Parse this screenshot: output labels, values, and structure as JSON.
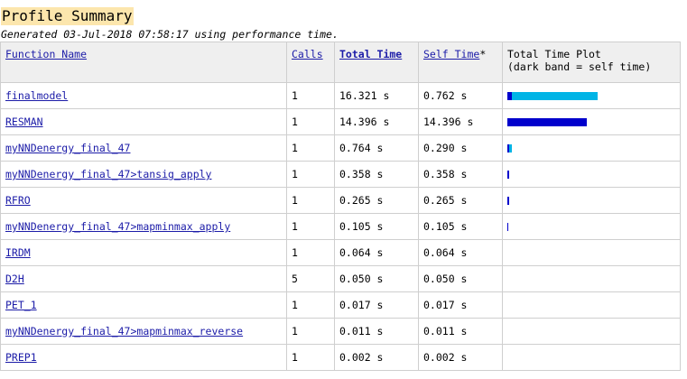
{
  "page": {
    "title": "Profile Summary",
    "subtitle": "Generated 03-Jul-2018 07:58:17 using performance time."
  },
  "table": {
    "headers": {
      "function_name": "Function Name",
      "calls": "Calls",
      "total_time": "Total Time",
      "self_time": "Self Time",
      "self_time_mark": "*",
      "plot_line1": "Total Time Plot",
      "plot_line2": "(dark band = self time)"
    },
    "rows": [
      {
        "name": "finalmodel",
        "calls": "1",
        "total": "16.321 s",
        "self": "0.762 s"
      },
      {
        "name": "RESMAN",
        "calls": "1",
        "total": "14.396 s",
        "self": "14.396 s"
      },
      {
        "name": "myNNDenergy_final_47",
        "calls": "1",
        "total": "0.764 s",
        "self": "0.290 s"
      },
      {
        "name": "myNNDenergy_final_47>tansig_apply",
        "calls": "1",
        "total": "0.358 s",
        "self": "0.358 s"
      },
      {
        "name": "RFRO",
        "calls": "1",
        "total": "0.265 s",
        "self": "0.265 s"
      },
      {
        "name": "myNNDenergy_final_47>mapminmax_apply",
        "calls": "1",
        "total": "0.105 s",
        "self": "0.105 s"
      },
      {
        "name": "IRDM",
        "calls": "1",
        "total": "0.064 s",
        "self": "0.064 s"
      },
      {
        "name": "D2H",
        "calls": "5",
        "total": "0.050 s",
        "self": "0.050 s"
      },
      {
        "name": "PET_1",
        "calls": "1",
        "total": "0.017 s",
        "self": "0.017 s"
      },
      {
        "name": "myNNDenergy_final_47>mapminmax_reverse",
        "calls": "1",
        "total": "0.011 s",
        "self": "0.011 s"
      },
      {
        "name": "PREP1",
        "calls": "1",
        "total": "0.002 s",
        "self": "0.002 s"
      }
    ]
  },
  "colors": {
    "title_highlight": "#fce6ad",
    "link": "#1c1ca8",
    "self_band": "#0000cc",
    "total_band": "#00b4e6"
  }
}
